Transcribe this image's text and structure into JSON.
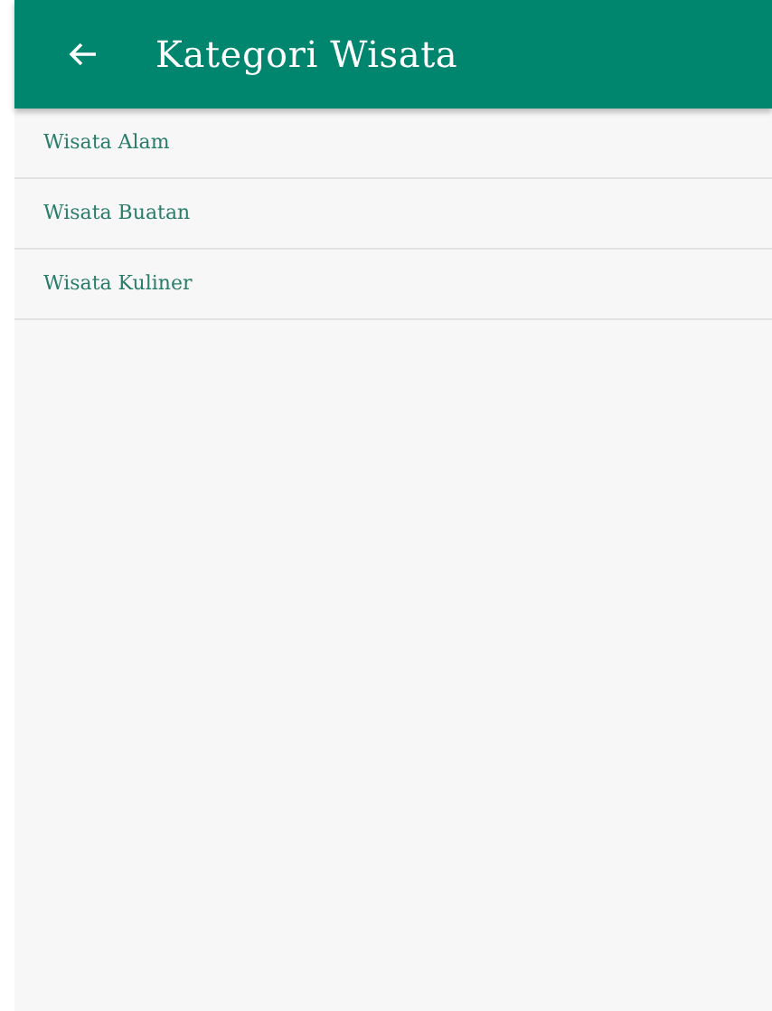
{
  "toolbar": {
    "title": "Kategori Wisata"
  },
  "categories": [
    {
      "label": "Wisata Alam"
    },
    {
      "label": "Wisata Buatan"
    },
    {
      "label": "Wisata Kuliner"
    }
  ]
}
